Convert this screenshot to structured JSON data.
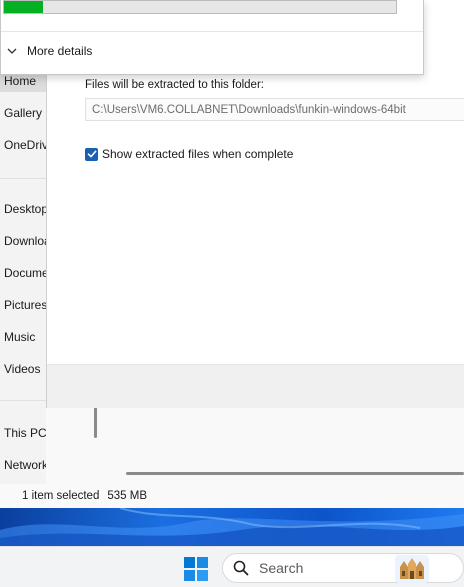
{
  "nav": {
    "items": [
      {
        "label": "Home"
      },
      {
        "label": "Gallery"
      },
      {
        "label": "OneDrive"
      },
      {
        "label": "Desktop"
      },
      {
        "label": "Downloads"
      },
      {
        "label": "Documents"
      },
      {
        "label": "Pictures"
      },
      {
        "label": "Music"
      },
      {
        "label": "Videos"
      },
      {
        "label": "This PC"
      },
      {
        "label": "Network"
      }
    ]
  },
  "status_bar": {
    "selection": "1 item selected",
    "size": "535 MB"
  },
  "progress_dialog": {
    "progress_fraction": 0.1,
    "progress_color": "#06b025",
    "more_details_label": "More details",
    "more_details_icon": "chevron-down-icon"
  },
  "extract_dialog": {
    "folder_label": "Files will be extracted to this folder:",
    "folder_path": "C:\\Users\\VM6.COLLABNET\\Downloads\\funkin-windows-64bit",
    "show_files_label": "Show extracted files when complete",
    "show_files_checked": true,
    "checkbox_color": "#1a5fb4"
  },
  "taskbar": {
    "start_icon": "windows-logo-icon",
    "search_icon": "search-icon",
    "search_label": "Search",
    "accent": "#0078d4"
  }
}
